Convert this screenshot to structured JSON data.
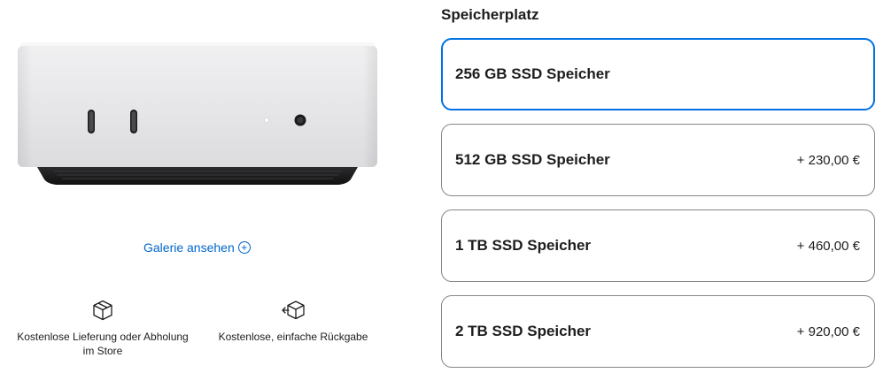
{
  "gallery": {
    "link_label": "Galerie ansehen",
    "plus_glyph": "+"
  },
  "benefits": [
    {
      "icon": "box-icon",
      "text_line1": "Kostenlose Lieferung oder Abholung",
      "text_line2": "im Store"
    },
    {
      "icon": "return-box-icon",
      "text_line1": "Kostenlose, einfache Rückgabe"
    }
  ],
  "storage": {
    "title": "Speicherplatz",
    "options": [
      {
        "label": "256 GB SSD Speicher",
        "price": "",
        "selected": true
      },
      {
        "label": "512 GB SSD Speicher",
        "price": "+ 230,00 €",
        "selected": false
      },
      {
        "label": "1 TB SSD Speicher",
        "price": "+ 460,00 €",
        "selected": false
      },
      {
        "label": "2 TB SSD Speicher",
        "price": "+ 920,00 €",
        "selected": false
      }
    ]
  },
  "colors": {
    "accent": "#0071e3",
    "link": "#0066cc",
    "border": "#86868b",
    "text": "#1d1d1f"
  }
}
